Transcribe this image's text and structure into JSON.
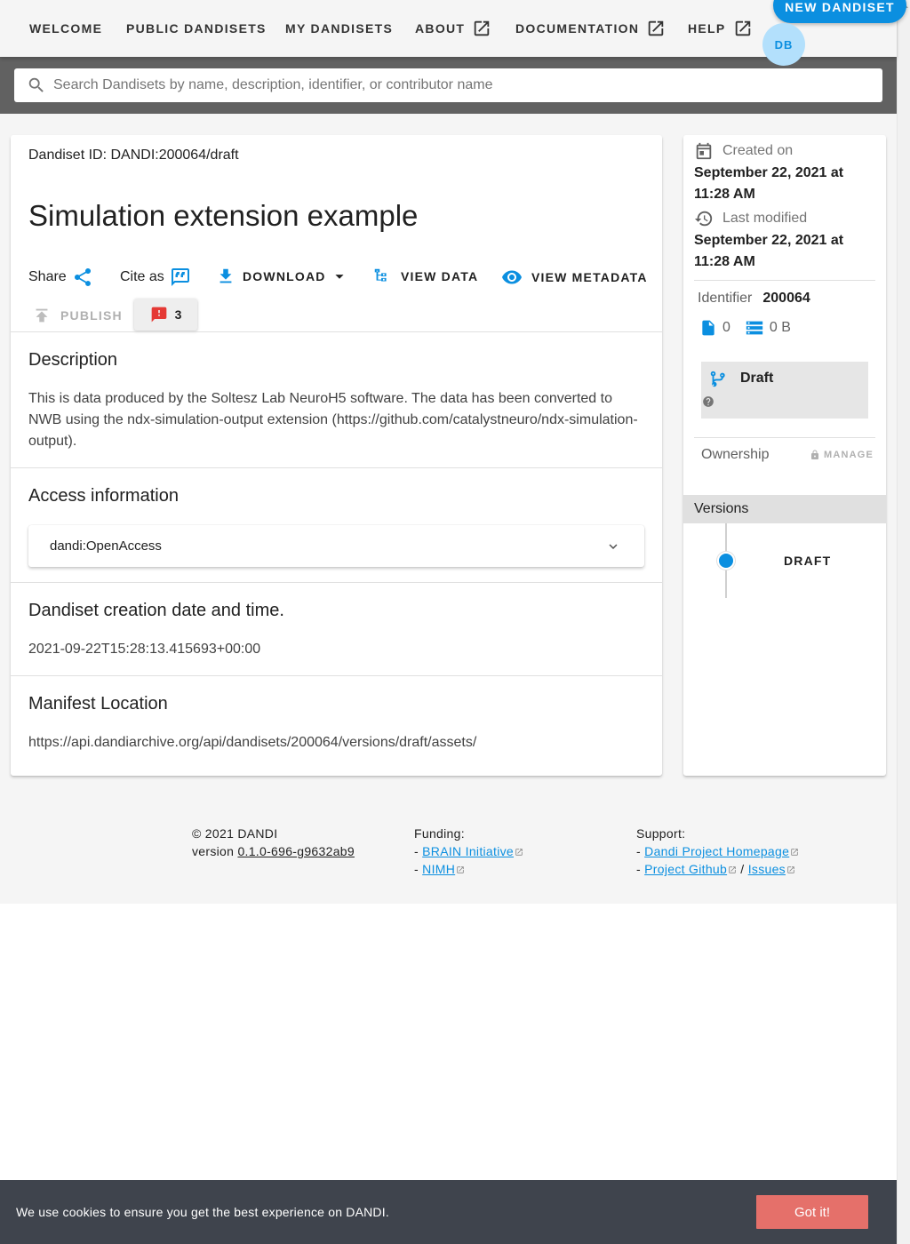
{
  "nav": {
    "items": [
      {
        "label": "WELCOME"
      },
      {
        "label": "PUBLIC DANDISETS"
      },
      {
        "label": "MY DANDISETS"
      },
      {
        "label": "ABOUT"
      },
      {
        "label": "DOCUMENTATION"
      },
      {
        "label": "HELP"
      }
    ],
    "new_dandiset_label": "NEW DANDISET",
    "avatar_initials": "DB"
  },
  "search": {
    "placeholder": "Search Dandisets by name, description, identifier, or contributor name"
  },
  "dandiset": {
    "id_label": "Dandiset ID: DANDI:200064/draft",
    "title": "Simulation extension example",
    "actions": {
      "share": "Share",
      "cite": "Cite as",
      "download": "DOWNLOAD",
      "view_data": "VIEW DATA",
      "view_metadata": "VIEW METADATA",
      "publish": "PUBLISH",
      "errors_count": "3"
    },
    "sections": {
      "description_heading": "Description",
      "description_text": "This is data produced by the Soltesz Lab NeuroH5 software. The data has been converted to NWB using the ndx-simulation-output extension (https://github.com/catalystneuro/ndx-simulation-output).",
      "access_heading": "Access information",
      "access_value": "dandi:OpenAccess",
      "creation_heading": "Dandiset creation date and time.",
      "creation_value": "2021-09-22T15:28:13.415693+00:00",
      "manifest_heading": "Manifest Location",
      "manifest_value": "https://api.dandiarchive.org/api/dandisets/200064/versions/draft/assets/"
    }
  },
  "sidebar": {
    "created_label": "Created on",
    "created_value": "September 22, 2021 at 11:28 AM",
    "modified_label": "Last modified",
    "modified_value": "September 22, 2021 at 11:28 AM",
    "identifier_label": "Identifier",
    "identifier_value": "200064",
    "file_count": "0",
    "size": "0 B",
    "draft_label": "Draft",
    "ownership_label": "Ownership",
    "manage_label": "MANAGE",
    "versions_label": "Versions",
    "version_item": "DRAFT"
  },
  "footer": {
    "copyright": "© 2021 DANDI",
    "version_prefix": "version",
    "version_value": "0.1.0-696-g9632ab9",
    "funding_label": "Funding:",
    "funding_links": [
      "BRAIN Initiative",
      "NIMH"
    ],
    "support_label": "Support:",
    "support_homepage": "Dandi Project Homepage",
    "support_github": "Project Github",
    "support_sep": "/",
    "support_issues": "Issues",
    "bullet": "-"
  },
  "cookie": {
    "text": "We use cookies to ensure you get the best experience on DANDI.",
    "button": "Got it!"
  },
  "colors": {
    "accent": "#0b8fe0",
    "search_band": "#616161",
    "error_red": "#e53935",
    "cookie_bg": "#3f444d",
    "cookie_btn": "#e5706a"
  },
  "icons": [
    "open-in-new-icon",
    "search-icon",
    "share-icon",
    "quote-icon",
    "download-icon",
    "caret-down-icon",
    "file-tree-icon",
    "eye-icon",
    "upload-icon",
    "alert-icon",
    "calendar-icon",
    "history-icon",
    "file-icon",
    "database-icon",
    "source-branch-icon",
    "help-icon",
    "lock-icon",
    "chevron-down-icon",
    "external-link-icon"
  ]
}
